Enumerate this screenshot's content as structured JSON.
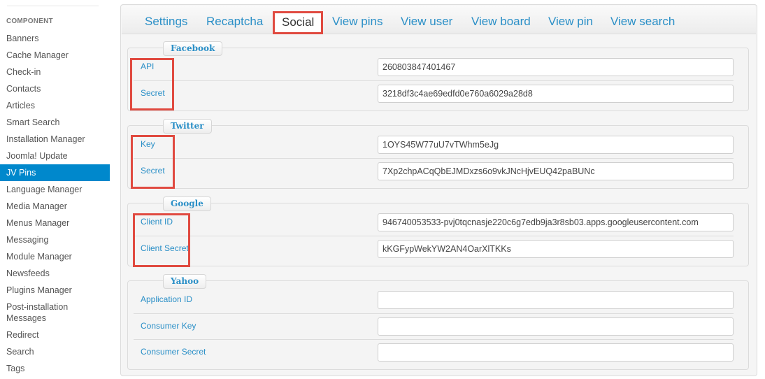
{
  "sidebar": {
    "heading": "COMPONENT",
    "items": [
      {
        "label": "Banners"
      },
      {
        "label": "Cache Manager"
      },
      {
        "label": "Check-in"
      },
      {
        "label": "Contacts"
      },
      {
        "label": "Articles"
      },
      {
        "label": "Smart Search"
      },
      {
        "label": "Installation Manager"
      },
      {
        "label": "Joomla! Update"
      },
      {
        "label": "JV Pins",
        "active": true
      },
      {
        "label": "Language Manager"
      },
      {
        "label": "Media Manager"
      },
      {
        "label": "Menus Manager"
      },
      {
        "label": "Messaging"
      },
      {
        "label": "Module Manager"
      },
      {
        "label": "Newsfeeds"
      },
      {
        "label": "Plugins Manager"
      },
      {
        "label": "Post-installation Messages"
      },
      {
        "label": "Redirect"
      },
      {
        "label": "Search"
      },
      {
        "label": "Tags"
      }
    ],
    "active_color": "#0088cc"
  },
  "tabs": [
    {
      "label": "Settings"
    },
    {
      "label": "Recaptcha"
    },
    {
      "label": "Social",
      "active": true
    },
    {
      "label": "View pins"
    },
    {
      "label": "View user"
    },
    {
      "label": "View board"
    },
    {
      "label": "View pin"
    },
    {
      "label": "View search"
    }
  ],
  "groups": {
    "facebook": {
      "legend": "Facebook",
      "fields": [
        {
          "label": "API",
          "value": "260803847401467"
        },
        {
          "label": "Secret",
          "value": "3218df3c4ae69edfd0e760a6029a28d8"
        }
      ]
    },
    "twitter": {
      "legend": "Twitter",
      "fields": [
        {
          "label": "Key",
          "value": "1OYS45W77uU7vTWhm5eJg"
        },
        {
          "label": "Secret",
          "value": "7Xp2chpACqQbEJMDxzs6o9vkJNcHjvEUQ42paBUNc"
        }
      ]
    },
    "google": {
      "legend": "Google",
      "fields": [
        {
          "label": "Client ID",
          "value": "946740053533-pvj0tqcnasje220c6g7edb9ja3r8sb03.apps.googleusercontent.com"
        },
        {
          "label": "Client Secret",
          "value": "kKGFypWekYW2AN4OarXlTKKs"
        }
      ]
    },
    "yahoo": {
      "legend": "Yahoo",
      "fields": [
        {
          "label": "Application ID",
          "value": ""
        },
        {
          "label": "Consumer Key",
          "value": ""
        },
        {
          "label": "Consumer Secret",
          "value": ""
        }
      ]
    }
  },
  "colors": {
    "link": "#2a8fc7",
    "highlight_box": "#e04a40"
  }
}
